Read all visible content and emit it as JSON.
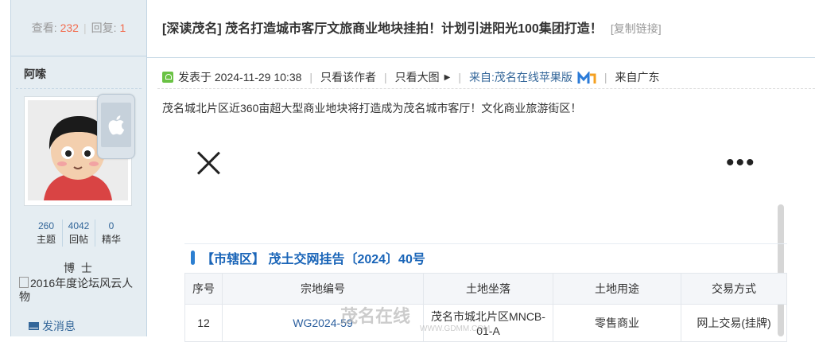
{
  "sidebar": {
    "stats": {
      "views_label": "查看:",
      "views": "232",
      "replies_label": "回复:",
      "replies": "1"
    },
    "author": "阿嗦",
    "user_stats": [
      {
        "value": "260",
        "label": "主题"
      },
      {
        "value": "4042",
        "label": "回帖"
      },
      {
        "value": "0",
        "label": "精华"
      }
    ],
    "rank": "博 士",
    "medal_alt": "2016年度论坛风云人物",
    "send_message": "发消息"
  },
  "post": {
    "title": "[深读茂名] 茂名打造城市客厅文旅商业地块挂拍！计划引进阳光100集团打造！",
    "copy_link": "[复制链接]",
    "meta": {
      "posted_at": "发表于 2024-11-29 10:38",
      "only_author": "只看该作者",
      "large_image": "只看大图",
      "source": "来自:茂名在线苹果版",
      "location": "来自广东"
    },
    "body": "茂名城北片区近360亩超大型商业地块将打造成为茂名城市客厅！文化商业旅游街区！",
    "image": {
      "notice": "【市辖区】 茂土交网挂告〔2024〕40号",
      "table_headers": [
        "序号",
        "宗地编号",
        "土地坐落",
        "土地用途",
        "交易方式"
      ],
      "table_row": [
        "12",
        "WG2024-59",
        "茂名市城北片区MNCB-01-A",
        "零售商业",
        "网上交易(挂牌)"
      ],
      "watermark": "茂名在线",
      "watermark_url": "WWW.GDMM.COM"
    }
  }
}
